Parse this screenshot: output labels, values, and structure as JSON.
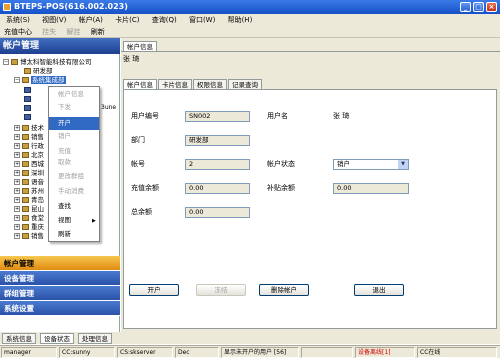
{
  "window": {
    "title": "BTEPS-POS(616.002.023)"
  },
  "menu": [
    {
      "label": "系统(S)"
    },
    {
      "label": "视图(V)"
    },
    {
      "label": "帐户(A)"
    },
    {
      "label": "卡片(C)"
    },
    {
      "label": "查询(Q)"
    },
    {
      "label": "窗口(W)"
    },
    {
      "label": "帮助(H)"
    }
  ],
  "toolbar": {
    "items": [
      {
        "label": "充值中心",
        "enabled": true
      },
      {
        "label": "挂失",
        "enabled": false
      },
      {
        "label": "解挂",
        "enabled": false
      },
      {
        "label": "刷新",
        "enabled": true
      }
    ]
  },
  "left_panel": {
    "title": "帐户管理",
    "tree": {
      "root": "博太科智能科技有限公司",
      "children": [
        "研发部",
        "系统集成部",
        "技术",
        "销售",
        "行政",
        "北京",
        "西城",
        "深圳",
        "语音",
        "苏州",
        "青岛",
        "昆山",
        "食堂",
        "重庆",
        "销售"
      ],
      "partial": "3une"
    },
    "nav": [
      {
        "label": "帐户管理",
        "active": true
      },
      {
        "label": "设备管理",
        "active": false
      },
      {
        "label": "群组管理",
        "active": false
      },
      {
        "label": "系统设置",
        "active": false
      }
    ]
  },
  "context_menu": {
    "items": [
      {
        "label": "帐户信息",
        "enabled": false,
        "highlighted": false
      },
      {
        "label": "下发",
        "enabled": false,
        "highlighted": false
      },
      {
        "label": "开户",
        "enabled": true,
        "highlighted": true
      },
      {
        "label": "销户",
        "enabled": false,
        "highlighted": false
      },
      {
        "label": "充值",
        "enabled": false,
        "highlighted": false
      },
      {
        "label": "取款",
        "enabled": false,
        "highlighted": false
      },
      {
        "label": "更改群组",
        "enabled": false,
        "highlighted": false
      },
      {
        "label": "手动消费",
        "enabled": false,
        "highlighted": false
      },
      {
        "label": "查找",
        "enabled": true,
        "highlighted": false
      },
      {
        "label": "视图",
        "enabled": true,
        "highlighted": false,
        "submenu": true
      },
      {
        "label": "刷新",
        "enabled": true,
        "highlighted": false
      }
    ]
  },
  "right_panel": {
    "doc_tab": "帐户信息",
    "user_name_header": "张  琦",
    "tabs": [
      "帐户信息",
      "卡片信息",
      "权限信息",
      "记录查询"
    ],
    "form": {
      "user_no_label": "用户编号",
      "user_no": "SN002",
      "user_name_label": "用户名",
      "user_name": "张  琦",
      "dept_label": "部门",
      "dept": "研发部",
      "account_label": "帐号",
      "account": "2",
      "account_status_label": "帐户状态",
      "account_status": "销户",
      "recharge_balance_label": "充值余额",
      "recharge_balance": "0.00",
      "subsidy_balance_label": "补贴余额",
      "subsidy_balance": "0.00",
      "total_balance_label": "总余额",
      "total_balance": "0.00"
    },
    "buttons": {
      "open": "开户",
      "freeze": "冻结",
      "delete": "删除帐户",
      "exit": "退出"
    }
  },
  "bottom_tabs": [
    "系统信息",
    "设备状态",
    "处理信息"
  ],
  "status_bar": [
    "manager",
    "CC:sunny",
    "CS:skserver",
    "Dec",
    "显示未开户的用户 [56]",
    "",
    "设备离线[1]",
    "CC在线"
  ],
  "colors": {
    "title_bar": "#1650c8",
    "nav_active": "#f0a830",
    "nav_inactive": "#2a52a8",
    "status_alert": "#d00000"
  }
}
